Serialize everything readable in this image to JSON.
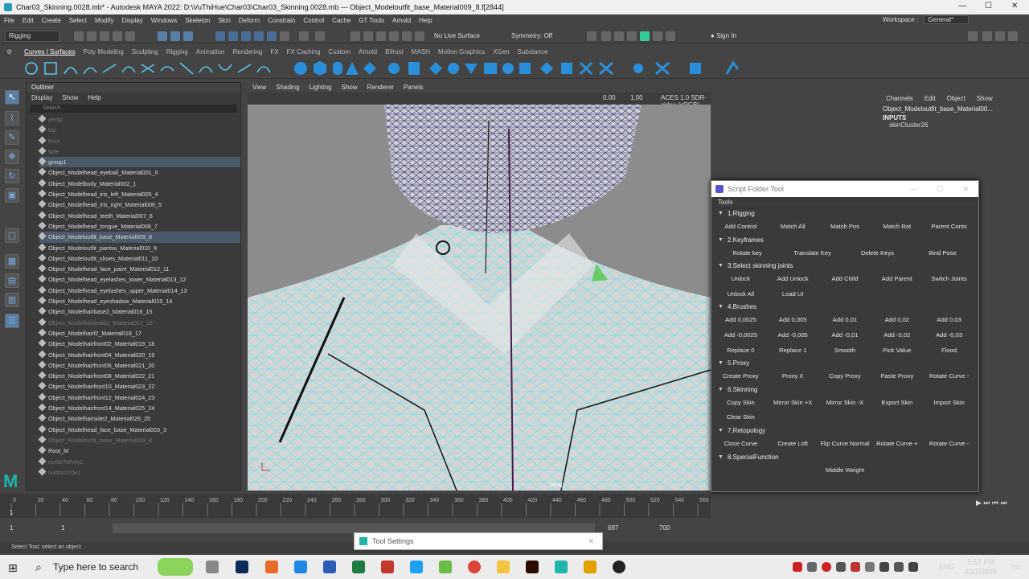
{
  "window": {
    "title": "Char03_Skinning.0028.mb* - Autodesk MAYA 2022: D:\\VuThiHue\\Char03\\Char03_Skinning.0028.mb   ---   Object_Modeloutfit_base_Material009_8.f[2844]"
  },
  "menu": [
    "File",
    "Edit",
    "Create",
    "Select",
    "Modify",
    "Display",
    "Windows",
    "Skeleton",
    "Skin",
    "Deform",
    "Constrain",
    "Control",
    "Cache",
    "GT Tools",
    "Arnold",
    "Help"
  ],
  "workspace": {
    "label": "Workspace :",
    "value": "General*"
  },
  "status": {
    "mode": "Rigging",
    "live_surface": "No Live Surface",
    "symmetry": "Symmetry: Off",
    "sign_in": "Sign In"
  },
  "shelf_tabs": [
    "Curves / Surfaces",
    "Poly Modeling",
    "Sculpting",
    "Rigging",
    "Animation",
    "Rendering",
    "FX",
    "FX Caching",
    "Custom",
    "Arnold",
    "Bifrost",
    "MASH",
    "Motion Graphics",
    "XGen",
    "Substance"
  ],
  "outliner": {
    "title": "Outliner",
    "menu": [
      "Display",
      "Show",
      "Help"
    ],
    "search_placeholder": "Search...",
    "items": [
      {
        "label": "persp",
        "dim": true
      },
      {
        "label": "top",
        "dim": true
      },
      {
        "label": "front",
        "dim": true
      },
      {
        "label": "side",
        "dim": true
      },
      {
        "label": "group1",
        "sel": true
      },
      {
        "label": "Object_Modelhead_eyeball_Material001_0"
      },
      {
        "label": "Object_Modelbody_Material002_1"
      },
      {
        "label": "Object_Modelhead_iris_left_Material005_4"
      },
      {
        "label": "Object_Modelhead_iris_right_Material006_5"
      },
      {
        "label": "Object_Modelhead_teeth_Material007_6"
      },
      {
        "label": "Object_Modelhead_tongue_Material008_7"
      },
      {
        "label": "Object_Modeloutfit_base_Material009_8",
        "sel": true
      },
      {
        "label": "Object_Modeloutfit_pantsu_Material010_9"
      },
      {
        "label": "Object_Modeloutfit_shoes_Material011_10"
      },
      {
        "label": "Object_Modelhead_face_paint_Material012_11"
      },
      {
        "label": "Object_Modelhead_eyelashes_lower_Material013_12"
      },
      {
        "label": "Object_Modelhead_eyelashes_upper_Material014_13"
      },
      {
        "label": "Object_Modelhead_eyeshadow_Material015_14"
      },
      {
        "label": "Object_Modelhairbase2_Material016_15"
      },
      {
        "label": "Object_Modelhairbraid2_Material017_16",
        "dim": true
      },
      {
        "label": "Object_Modelhairf2_Material018_17"
      },
      {
        "label": "Object_Modelhairfront02_Material019_18"
      },
      {
        "label": "Object_Modelhairfront04_Material020_19"
      },
      {
        "label": "Object_Modelhairfront06_Material021_20"
      },
      {
        "label": "Object_Modelhairfront08_Material022_21"
      },
      {
        "label": "Object_Modelhairfront10_Material023_22"
      },
      {
        "label": "Object_Modelhairfront12_Material024_23"
      },
      {
        "label": "Object_Modelhairfront14_Material025_24"
      },
      {
        "label": "Object_Modelhairside2_Material026_25"
      },
      {
        "label": "Object_Modelhead_face_base_Material003_3"
      },
      {
        "label": "Object_Modeloutfit_base_Material009_8",
        "dim": true
      },
      {
        "label": "Root_M"
      },
      {
        "label": "nurbsToPoly1",
        "dim": true
      },
      {
        "label": "nurbsCircle1",
        "dim": true
      }
    ]
  },
  "viewport": {
    "menu": [
      "View",
      "Shading",
      "Lighting",
      "Show",
      "Renderer",
      "Panels"
    ],
    "exposure": "0.00",
    "gamma": "1.00",
    "colorspace": "ACES 1.0 SDR-video (sRGB)",
    "camera": "persp"
  },
  "channel_box": {
    "menu": [
      "Channels",
      "Edit",
      "Object",
      "Show"
    ],
    "object": "Object_Modeloutfit_base_Material00...",
    "inputs": "INPUTS",
    "input_node": "skinCluster26"
  },
  "script_tool": {
    "title": "Script Folder Tool",
    "tools_label": "Tools",
    "sections": [
      {
        "title": "1.Rigging",
        "rows": [
          [
            "Add Control",
            "Match All",
            "Match Pos",
            "Match Rot",
            "Parent Conts"
          ]
        ]
      },
      {
        "title": "2.Keyframes",
        "rows": [
          [
            "Rotate key",
            "Translate Key",
            "Delete Keys",
            "Bind Pose"
          ]
        ]
      },
      {
        "title": "3.Select skinning joints",
        "rows": [
          [
            "Unlock",
            "Add Unlock",
            "Add Child",
            "Add Parent",
            "Switch Joints"
          ],
          [
            "Unlock All",
            "Load UI",
            "",
            "",
            ""
          ]
        ]
      },
      {
        "title": "4.Brushes",
        "rows": [
          [
            "Add 0,0025",
            "Add 0,005",
            "Add 0,01",
            "Add 0,02",
            "Add 0,03"
          ],
          [
            "Add -0,0025",
            "Add -0,005",
            "Add -0,01",
            "Add -0,02",
            "Add -0,03"
          ],
          [
            "Replace 0",
            "Replace 1",
            "Smooth",
            "Pick Value",
            "Flood"
          ]
        ]
      },
      {
        "title": "5.Proxy",
        "rows": [
          [
            "Create Proxy",
            "Proxy X",
            "Copy Proxy",
            "Paste Proxy",
            "Rotate Curve -"
          ]
        ]
      },
      {
        "title": "6.Skinning",
        "rows": [
          [
            "Copy Skin",
            "Mirror Skin +X",
            "Mirror Skin -X",
            "Export Skin",
            "Import Skin"
          ],
          [
            "Clear Skin",
            "",
            "",
            "",
            ""
          ]
        ]
      },
      {
        "title": "7.Retopology",
        "rows": [
          [
            "Close Curve",
            "Create Loft",
            "Flip Curve Normal",
            "Rotate Curve +",
            "Rotate Curve -"
          ]
        ]
      },
      {
        "title": "8.SpecialFunction",
        "rows": [
          [
            "",
            "",
            "Middle Weight",
            "",
            ""
          ]
        ]
      }
    ]
  },
  "timeline": {
    "ticks": [
      "0",
      "20",
      "40",
      "60",
      "80",
      "100",
      "120",
      "140",
      "160",
      "180",
      "200",
      "220",
      "240",
      "260",
      "280",
      "300",
      "320",
      "340",
      "360",
      "380",
      "400",
      "420",
      "440",
      "460",
      "480",
      "500",
      "520",
      "540",
      "560"
    ],
    "current_frame": "1"
  },
  "range": {
    "start": "1",
    "start2": "1",
    "end_shown": "697",
    "end2": "700"
  },
  "command": {
    "help": "Select Tool: select an object"
  },
  "tool_settings": {
    "title": "Tool Settings"
  },
  "taskbar": {
    "search": "Type here to search",
    "time": "3:57 PM",
    "date": "2/17/2026",
    "lang": "ENG"
  }
}
